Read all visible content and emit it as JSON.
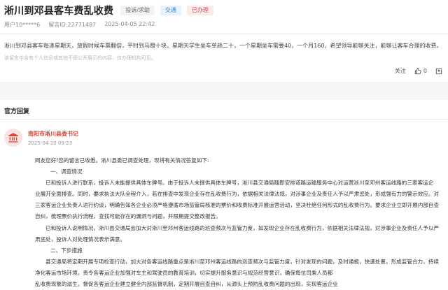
{
  "post": {
    "title": "淅川到邓县客车费乱收费",
    "tags": [
      "投诉/求助",
      "交通",
      "已办理"
    ],
    "user": "用户10*****6",
    "post_id": "留言ID:22771487",
    "time": "2025-04-05 22:42",
    "content": "淅川到邓县客车每逢星期天，放假时候车票翻倍，平时到马蹬十块，星期天学生坐车单趟二十，一个星期坐车需要40，一个月160，希望领导能够关注，能够让客车合理的收费。",
    "notice": "该留言中含有个人信息或其他不便公开展示的内容，仅办理机构可见。"
  },
  "actions": {
    "follow": "关注",
    "like_count": "0"
  },
  "reply_section": {
    "title": "官方回复"
  },
  "reply": {
    "org": "南阳市淅川县委书记",
    "time": "2025-04-10 09:23",
    "lines": [
      "网友您好!您的留言已收悉。淅川县委已调查处理，现将有关情况答复如下:",
      "一、调查情况",
      "已和投诉人进行联系，投诉人未能提供具体车牌号。由于投诉人未提供具体车牌号，淅川县交通局随即安排道路运输服务中心对运营淅川至邓州客运线路的三家客运企",
      "业展开全面排查。同时，要求执法大队全程介入，若在排查中发现企业存在乱收费行为，依据相关法律法规，对涉事企业及责任人予以严肃惩处，形成强有力的警示效应。对",
      "三家客运企业负责人进行约谈，明确告知各企业必须严格遵循市场监管局核准的票价和收费标准开展运营活动，坚决杜绝任何形式的乱收费行为。要求企业立即开展内部自查",
      "自纠，梳理票价执行流程，查找可能存在的漏洞与问题，并限期提交整改报告。",
      "已和投诉人说明情况，淅川县交通局会加大对淅川至邓州客运线路的巡查频次与监管力度，如发现企业存在乱收费行为，依据相关法律法规，对涉事企业及责任人予以严",
      "肃惩处，投诉人对处理情况表示满意。",
      "二、下步措施",
      "县交通局将定期开展专项检查行动，加大对各客运线路重点是淅川至邓州客运线路的巡查频次与监管力度，针对发现的问题，及时通报，快速处置，形成监管合力，持续",
      "净化客运市场环境。责令各客运企业加强对车主和驾驶员的教育培训，切实提升服务意识与规范经营意识，确保每位司乘人员都",
      "乱收费现象的滋生。督促各客运企业建立健全内部监督机制，定期开展自查自纠，从源头上预防乱收费问题的出现，实现客运企业"
    ]
  }
}
